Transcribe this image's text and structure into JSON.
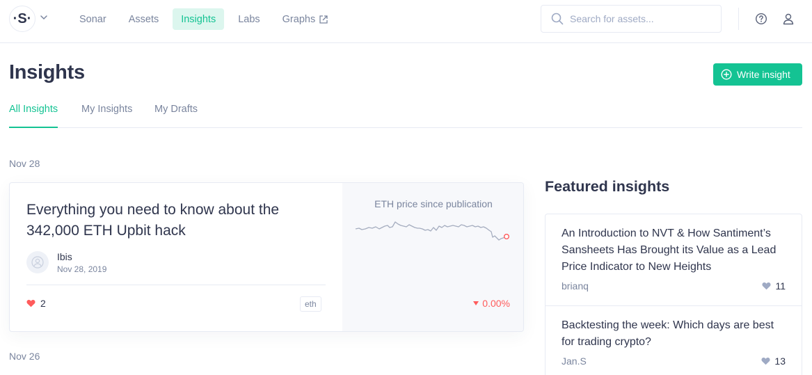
{
  "header": {
    "logo_glyph": "·S·",
    "nav": [
      {
        "label": "Sonar"
      },
      {
        "label": "Assets"
      },
      {
        "label": "Insights",
        "active": true
      },
      {
        "label": "Labs"
      },
      {
        "label": "Graphs",
        "icon": "external-link-icon"
      }
    ],
    "search": {
      "placeholder": "Search for assets..."
    },
    "icons": [
      "search-icon",
      "help-icon",
      "user-icon",
      "chevron-down-icon"
    ]
  },
  "page": {
    "title": "Insights",
    "write_button": "Write insight",
    "tabs": [
      {
        "label": "All Insights",
        "active": true
      },
      {
        "label": "My Insights"
      },
      {
        "label": "My Drafts"
      }
    ]
  },
  "feed": [
    {
      "date": "Nov 28",
      "card": {
        "title": "Everything you need to know about the 342,000 ETH Upbit hack",
        "author": "Ibis",
        "published": "Nov 28, 2019",
        "likes": "2",
        "tag": "eth",
        "chart_caption": "ETH price since publication",
        "price_change": "0.00%"
      }
    },
    {
      "date": "Nov 26"
    }
  ],
  "featured": {
    "title": "Featured insights",
    "items": [
      {
        "title": "An Introduction to NVT & How Santiment’s Sansheets Has Brought its Value as a Lead Price Indicator to New Heights",
        "author": "brianq",
        "likes": "11"
      },
      {
        "title": "Backtesting the week: Which days are best for trading crypto?",
        "author": "Jan.S",
        "likes": "13"
      }
    ]
  },
  "colors": {
    "accent": "#14c393",
    "accent_light": "#dcf6ee",
    "text": "#2f354d",
    "muted": "#7a859e",
    "border": "#e7eaf3",
    "negative": "#ff5b5b",
    "heart_red": "#ff5b5b",
    "heart_gray": "#9faac4"
  }
}
